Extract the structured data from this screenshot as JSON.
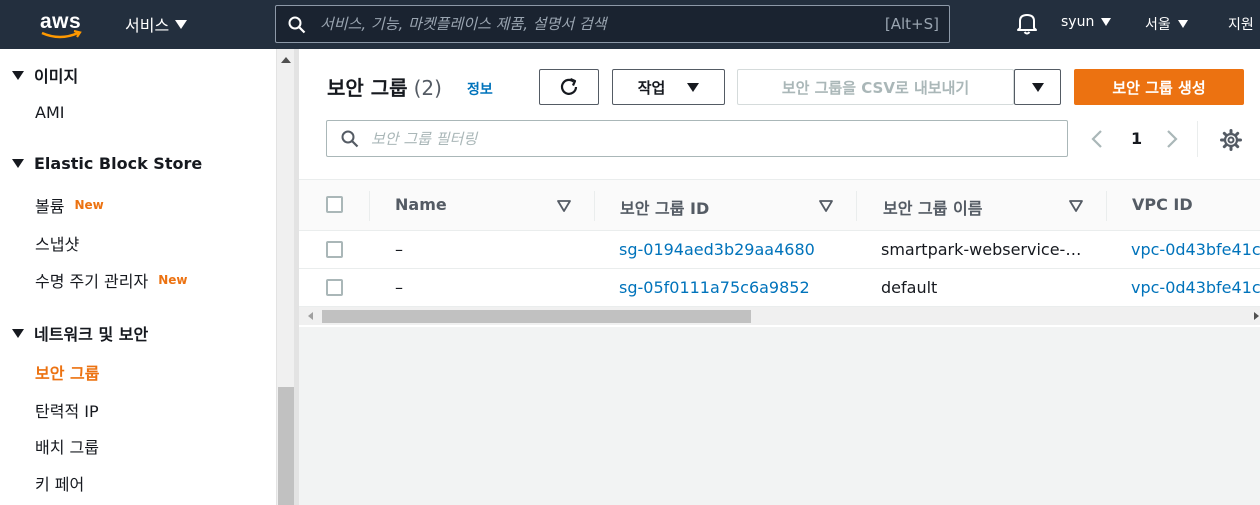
{
  "topnav": {
    "logo_text": "aws",
    "services_label": "서비스",
    "search_placeholder": "서비스, 기능, 마켓플레이스 제품, 설명서 검색",
    "search_shortcut": "[Alt+S]",
    "user": "syun",
    "region": "서울",
    "support": "지원"
  },
  "sidebar": {
    "sections": [
      {
        "label": "이미지",
        "items": [
          {
            "label": "AMI"
          }
        ]
      },
      {
        "label": "Elastic Block Store",
        "items": [
          {
            "label": "볼륨",
            "badge": "New"
          },
          {
            "label": "스냅샷"
          },
          {
            "label": "수명 주기 관리자",
            "badge": "New"
          }
        ]
      },
      {
        "label": "네트워크 및 보안",
        "items": [
          {
            "label": "보안 그룹",
            "active": true
          },
          {
            "label": "탄력적 IP"
          },
          {
            "label": "배치 그룹"
          },
          {
            "label": "키 페어"
          }
        ]
      }
    ]
  },
  "main": {
    "title": "보안 그룹",
    "count": "(2)",
    "info": "정보",
    "actions_label": "작업",
    "export_label": "보안 그룹을 CSV로 내보내기",
    "create_label": "보안 그룹 생성",
    "filter_placeholder": "보안 그룹 필터링",
    "page": "1",
    "columns": [
      "Name",
      "보안 그룹 ID",
      "보안 그룹 이름",
      "VPC ID"
    ],
    "rows": [
      {
        "name": "–",
        "id": "sg-0194aed3b29aa4680",
        "group_name": "smartpark-webservice-…",
        "vpc": "vpc-0d43bfe41c"
      },
      {
        "name": "–",
        "id": "sg-05f0111a75c6a9852",
        "group_name": "default",
        "vpc": "vpc-0d43bfe41c"
      }
    ]
  },
  "colors": {
    "nav_bg": "#232f3e",
    "accent_orange": "#ec7211",
    "link_blue": "#0073bb"
  }
}
